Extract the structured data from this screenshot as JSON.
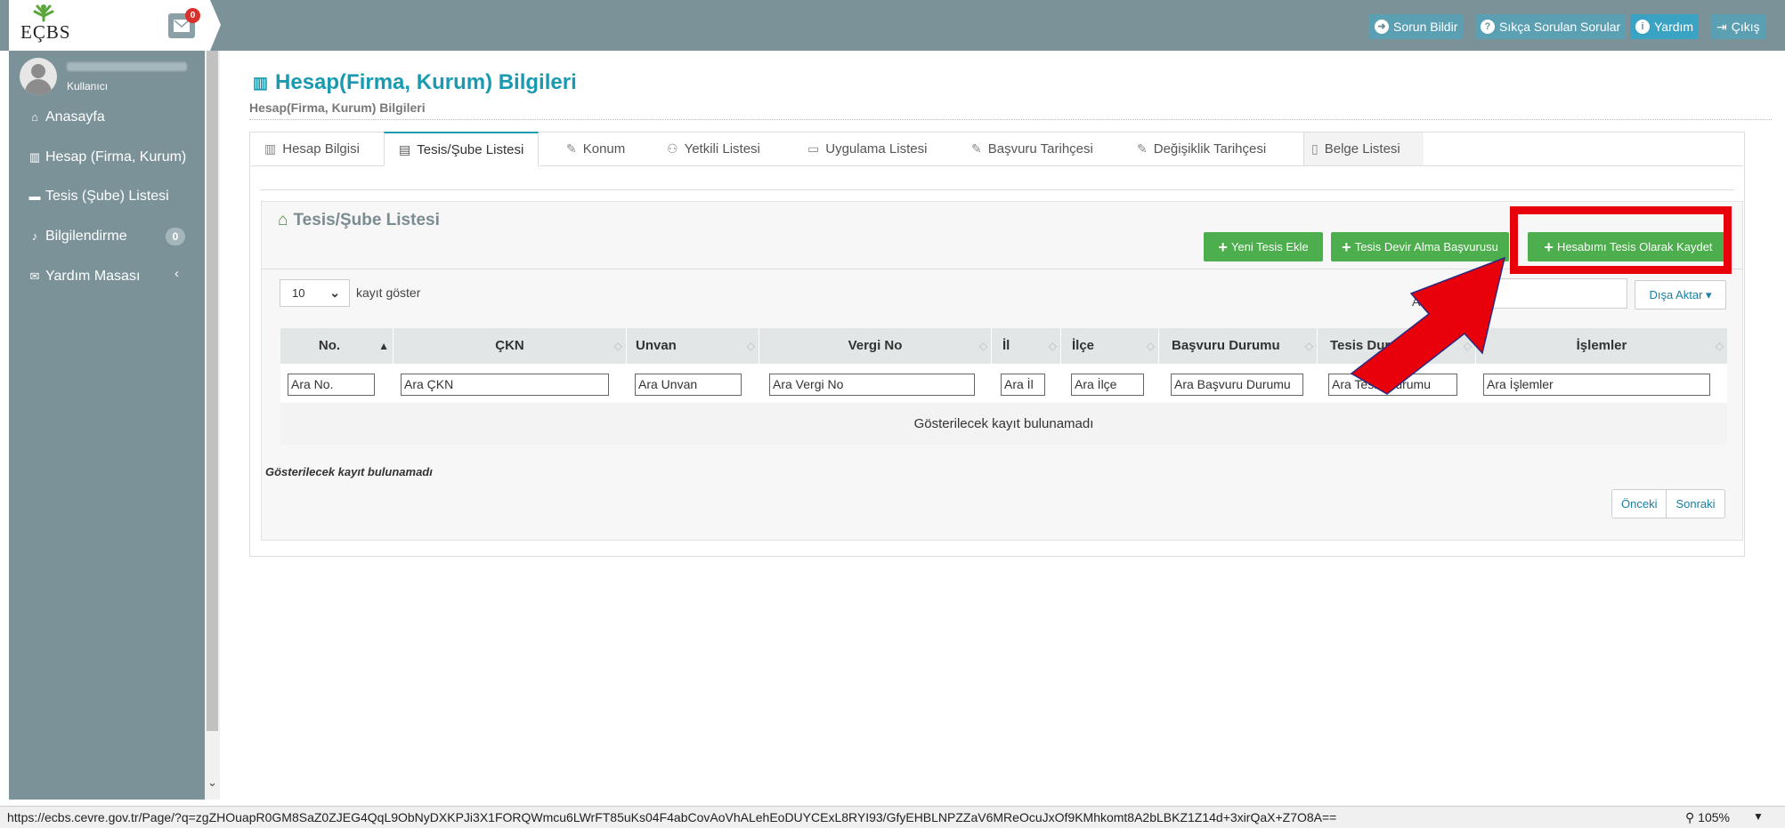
{
  "app": {
    "logo_text": "EÇBS",
    "mail_count": "0"
  },
  "topbar": {
    "report": "Sorun Bildir",
    "faq": "Sıkça Sorulan Sorular",
    "help": "Yardım",
    "logout": "Çıkış"
  },
  "user": {
    "role": "Kullanıcı"
  },
  "sidebar": {
    "items": [
      {
        "label": "Anasayfa",
        "icon": "home-icon"
      },
      {
        "label": "Hesap (Firma, Kurum)",
        "icon": "building-icon"
      },
      {
        "label": "Tesis (Şube) Listesi",
        "icon": "store-icon"
      },
      {
        "label": "Bilgilendirme",
        "icon": "bell-icon",
        "badge": "0"
      },
      {
        "label": "Yardım Masası",
        "icon": "envelope-icon"
      }
    ]
  },
  "page": {
    "title": "Hesap(Firma, Kurum) Bilgileri",
    "subtitle": "Hesap(Firma, Kurum) Bilgileri"
  },
  "tabs": [
    {
      "label": "Hesap Bilgisi",
      "icon": "building-icon"
    },
    {
      "label": "Tesis/Şube Listesi",
      "icon": "clipboard-icon",
      "active": true
    },
    {
      "label": "Konum",
      "icon": "edit-icon"
    },
    {
      "label": "Yetkili Listesi",
      "icon": "users-icon"
    },
    {
      "label": "Uygulama Listesi",
      "icon": "laptop-icon"
    },
    {
      "label": "Başvuru Tarihçesi",
      "icon": "edit-icon"
    },
    {
      "label": "Değişiklik Tarihçesi",
      "icon": "edit-icon"
    },
    {
      "label": "Belge Listesi",
      "icon": "file-icon"
    }
  ],
  "box": {
    "title": "Tesis/Şube Listesi",
    "buttons": {
      "add_facility": "Yeni Tesis Ekle",
      "transfer": "Tesis Devir Alma Başvurusu",
      "save_account": "Hesabımı Tesis Olarak Kaydet"
    },
    "length_value": "10",
    "length_label": "kayıt göster",
    "search_label": "Ara:",
    "export": "Dışa Aktar"
  },
  "table": {
    "columns": [
      "No.",
      "ÇKN",
      "Unvan",
      "Vergi No",
      "İl",
      "İlçe",
      "Başvuru Durumu",
      "Tesis Durumu",
      "İşlemler"
    ],
    "filters": [
      "Ara No.",
      "Ara ÇKN",
      "Ara Unvan",
      "Ara Vergi No",
      "Ara İl",
      "Ara İlçe",
      "Ara Başvuru Durumu",
      "Ara Tesis Durumu",
      "Ara İşlemler"
    ],
    "empty_message": "Gösterilecek kayıt bulunamadı"
  },
  "footer": {
    "info": "Gösterilecek kayıt bulunamadı",
    "prev": "Önceki",
    "next": "Sonraki"
  },
  "statusbar": {
    "url": "https://ecbs.cevre.gov.tr/Page/?q=zgZHOuapR0GM8SaZ0ZJEG4QqL9ObNyDXKPJi3X1FORQWmcu6LWrFT85uKs04F4abCovAoVhALehEoDUYCExL8RYI93/GfyEHBLNPZZaV6MReOcuJxOf9KMhkomt8A2bLBKZ1Z14d+3xirQaX+Z7O8A==",
    "zoom": "105%"
  },
  "colors": {
    "sidebar": "#7b9299",
    "accent": "#1a9ab0",
    "green": "#4cae4c",
    "highlight": "#e8000b"
  }
}
